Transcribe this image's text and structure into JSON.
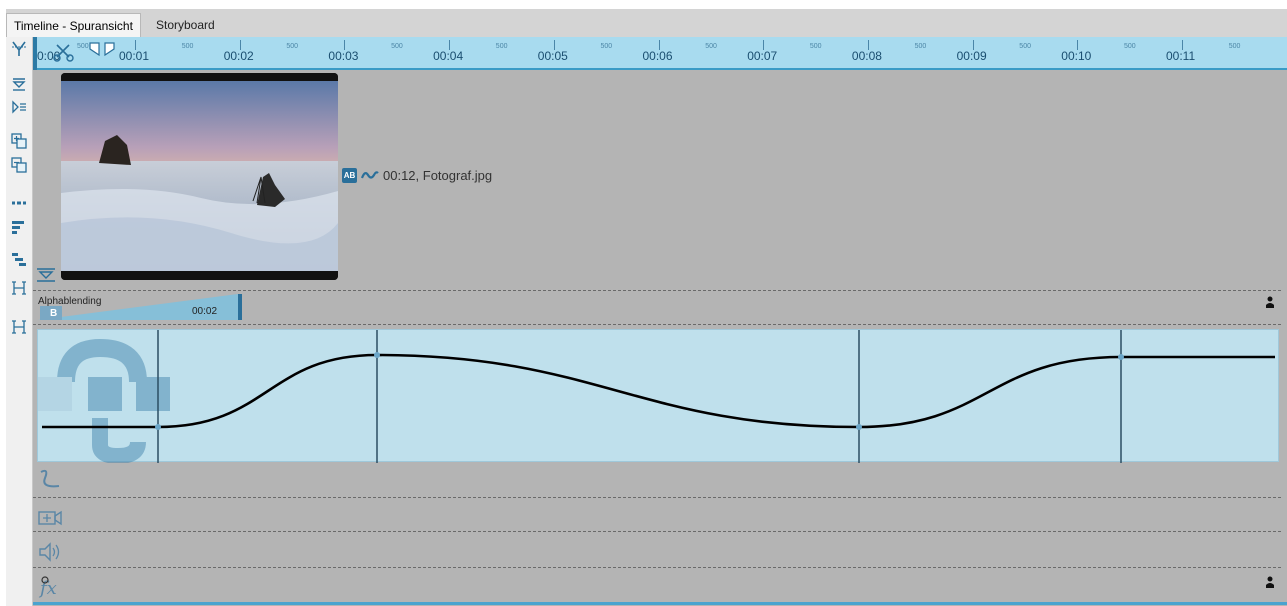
{
  "tabs": [
    {
      "label": "Timeline - Spuransicht",
      "active": true
    },
    {
      "label": "Storyboard",
      "active": false
    }
  ],
  "ruler": {
    "start_label": "0:00",
    "labels": [
      "00:01",
      "00:02",
      "00:03",
      "00:04",
      "00:05",
      "00:06",
      "00:07",
      "00:08",
      "00:09",
      "00:10",
      "00:11"
    ],
    "sub_label": "500"
  },
  "clip": {
    "info": "00:12, Fotograf.jpg",
    "badge": "AB"
  },
  "alpha": {
    "label": "Alphablending",
    "time": "00:02",
    "badge": "B"
  },
  "toolbar_icons": [
    "split-clip-icon",
    "collapse-tracks-icon",
    "expand-tracks-icon",
    "add-track-icon",
    "remove-track-icon",
    "dash-line-icon",
    "align-left-icon",
    "align-stagger-icon",
    "bracket-icon",
    "bracket-icon-2"
  ],
  "lane_icons": [
    "motion-path-icon",
    "camera-track-icon",
    "audio-track-icon",
    "effect-fx-icon"
  ],
  "colors": {
    "ruler_bg": "#a8dbef",
    "accent": "#3a9bc6",
    "track_bg": "#b4b4b4",
    "curve_panel": "#bfe0ec"
  }
}
